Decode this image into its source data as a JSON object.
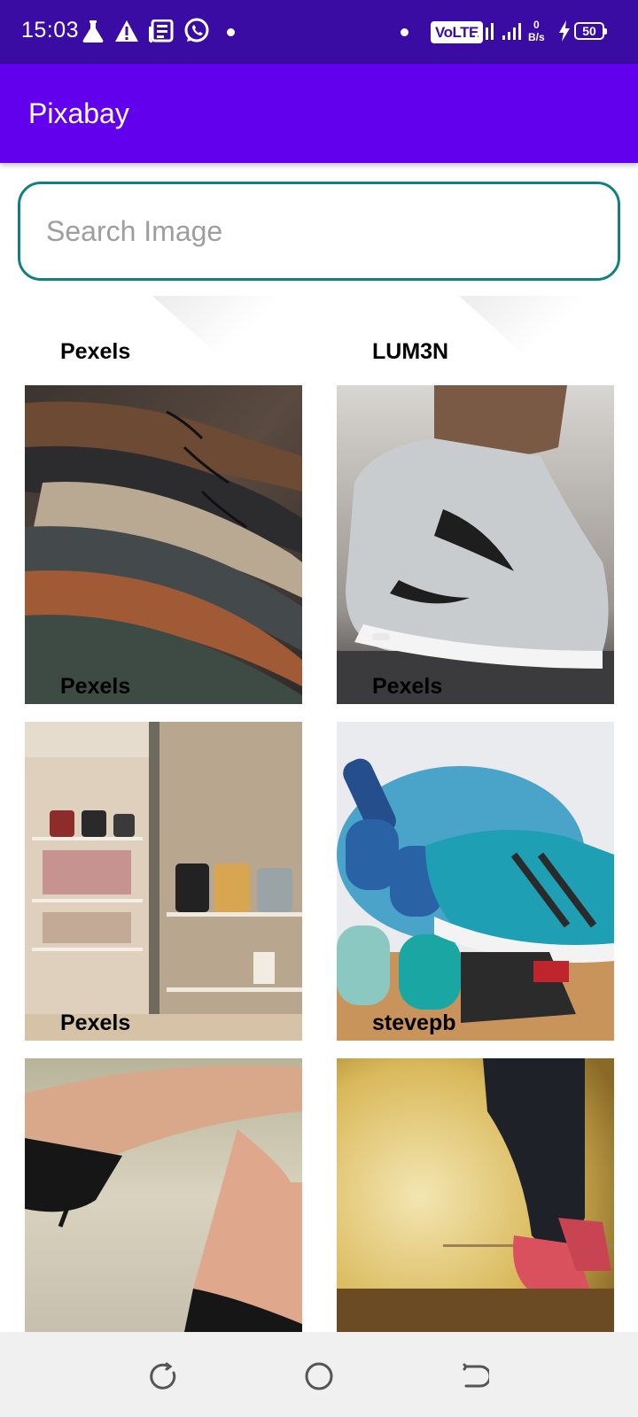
{
  "status_bar": {
    "time": "15:03",
    "network_label": "VoLTE",
    "speed_value": "0",
    "speed_unit": "B/s",
    "battery": "50",
    "icons": [
      "flask-icon",
      "warning-icon",
      "news-icon",
      "whatsapp-icon",
      "signal-icon",
      "charging-icon"
    ]
  },
  "app_bar": {
    "title": "Pixabay"
  },
  "search": {
    "placeholder": "Search Image",
    "value": ""
  },
  "header_row": [
    {
      "user": "Pexels"
    },
    {
      "user": "LUM3N"
    }
  ],
  "grid": [
    {
      "user": "Pexels",
      "subject": "leather-shoes-row"
    },
    {
      "user": "Pexels",
      "subject": "white-sneaker"
    },
    {
      "user": "Pexels",
      "subject": "handbag-store"
    },
    {
      "user": "stevepb",
      "subject": "dumbbells-and-running-shoe"
    },
    {
      "user": "",
      "subject": "high-heels"
    },
    {
      "user": "",
      "subject": "walking-sneakers-sunset"
    }
  ],
  "nav_bar": {
    "buttons": [
      "recents-button",
      "home-button",
      "back-button"
    ]
  },
  "colors": {
    "status_bar": "#3a0ca3",
    "app_bar": "#6200ee",
    "search_border": "#128080",
    "nav_bar": "#f0f0f0"
  }
}
